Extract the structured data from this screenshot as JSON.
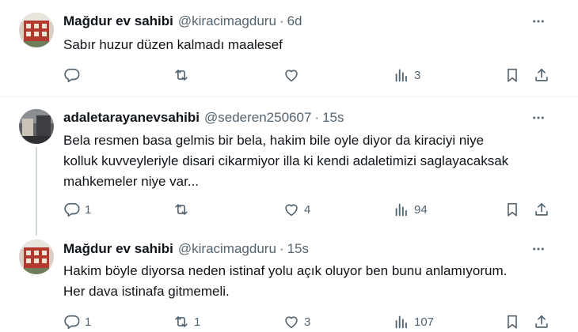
{
  "tweets": [
    {
      "name": "Mağdur ev sahibi",
      "handle": "@kiracimagduru",
      "time": "6d",
      "lines": [
        "Sabır huzur düzen kalmadı maalesef"
      ],
      "replies": "",
      "retweets": "",
      "likes": "",
      "views": "3"
    },
    {
      "name": "adaletarayanevsahibi",
      "handle": "@sederen250607",
      "time": "15s",
      "lines": [
        "Bela resmen basa gelmis bir bela, hakim bile oyle diyor da kiraciyi niye",
        "kolluk kuvveyleriyle disari cikarmiyor illa ki kendi adaletimizi saglayacaksak",
        "mahkemeler niye var..."
      ],
      "replies": "1",
      "retweets": "",
      "likes": "4",
      "views": "94"
    },
    {
      "name": "Mağdur ev sahibi",
      "handle": "@kiracimagduru",
      "time": "15s",
      "lines": [
        "Hakim böyle diyorsa neden istinaf yolu açık oluyor ben bunu anlamıyorum.",
        "Her dava istinafa gitmemeli."
      ],
      "replies": "1",
      "retweets": "1",
      "likes": "3",
      "views": "107"
    }
  ],
  "separator": "·",
  "icons": {
    "more": "more-horizontal-icon",
    "reply": "reply-icon",
    "retweet": "retweet-icon",
    "like": "like-heart-icon",
    "views": "views-chart-icon",
    "bookmark": "bookmark-icon",
    "share": "share-icon"
  },
  "colors": {
    "text": "#0f1419",
    "secondary": "#536471",
    "divider": "#eff3f4",
    "thread": "#cfd9de"
  }
}
